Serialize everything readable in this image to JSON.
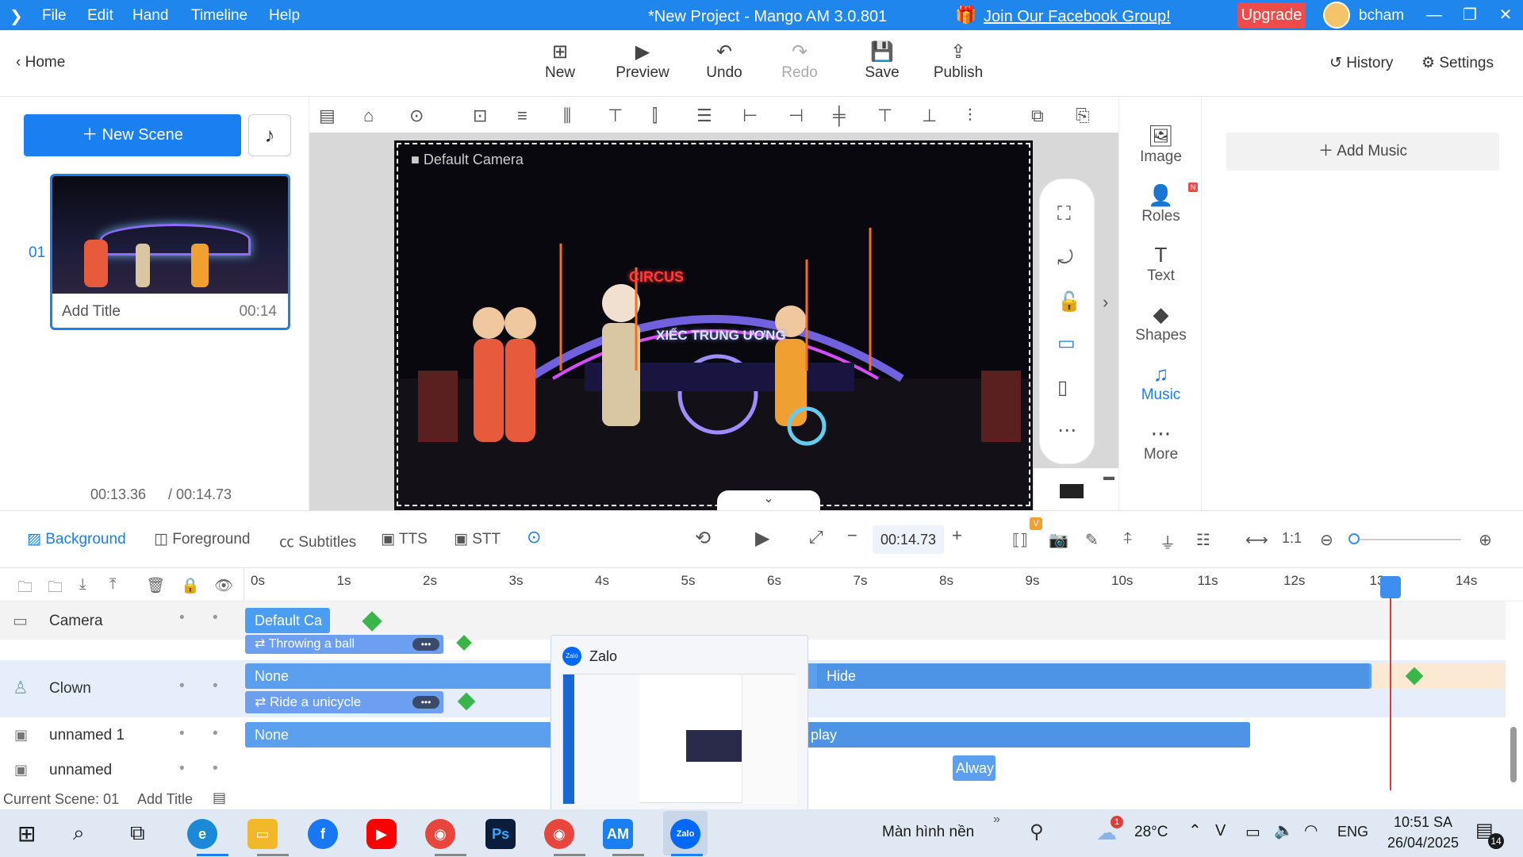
{
  "titlebar": {
    "menu": [
      "File",
      "Edit",
      "Hand",
      "Timeline",
      "Help"
    ],
    "title": "*New Project - Mango AM 3.0.801",
    "facebook_link": "Join Our Facebook Group!",
    "upgrade": "Upgrade",
    "username": "bcham"
  },
  "toolbar": {
    "home": "Home",
    "new": "New",
    "preview": "Preview",
    "undo": "Undo",
    "redo": "Redo",
    "save": "Save",
    "publish": "Publish",
    "history": "History",
    "settings": "Settings"
  },
  "scenes": {
    "new_scene": "New Scene",
    "items": [
      {
        "number": "01",
        "title": "Add Title",
        "duration": "00:14"
      }
    ],
    "time_current": "00:13.36",
    "time_total": "/ 00:14.73"
  },
  "stage": {
    "camera_label": "Default Camera",
    "sign_circus": "CIRCUS",
    "sign_banner": "XIẾC TRUNG ƯƠNG"
  },
  "assets": {
    "tabs": [
      {
        "label": "Image",
        "icon": "image-icon"
      },
      {
        "label": "Roles",
        "icon": "roles-icon",
        "badge": "N"
      },
      {
        "label": "Text",
        "icon": "text-icon"
      },
      {
        "label": "Shapes",
        "icon": "shapes-icon"
      },
      {
        "label": "Music",
        "icon": "music-icon",
        "active": true
      },
      {
        "label": "More",
        "icon": "more-icon"
      }
    ],
    "add_music": "Add Music"
  },
  "lower": {
    "tabs": [
      "Background",
      "Foreground",
      "Subtitles",
      "TTS",
      "STT"
    ],
    "time": "00:14.73",
    "badge_v": "V"
  },
  "timeline": {
    "ruler": [
      "0s",
      "1s",
      "2s",
      "3s",
      "4s",
      "5s",
      "6s",
      "7s",
      "8s",
      "9s",
      "10s",
      "11s",
      "12s",
      "13s",
      "14s"
    ],
    "tracks": [
      {
        "name": "Camera",
        "bar": "Default Ca"
      },
      {
        "name": "",
        "bar": "Throwing a ball"
      },
      {
        "name": "Clown",
        "bar": "None",
        "bar2": "Hide",
        "action": "Ride a unicycle"
      },
      {
        "name": "unnamed 1",
        "bar": "None",
        "bar2": "play"
      },
      {
        "name": "unnamed",
        "bar": "Alway"
      }
    ],
    "current_scene": "Current Scene: 01",
    "add_title": "Add Title"
  },
  "popup": {
    "title": "Zalo"
  },
  "taskbar": {
    "desktop_label": "Màn hình nền",
    "weather": "28°C",
    "weather_badge": "1",
    "lang": "ENG",
    "time": "10:51 SA",
    "date": "26/04/2025",
    "notifications": "14",
    "apps": [
      "Edge",
      "File Explorer",
      "Facebook",
      "YouTube",
      "Chrome",
      "Photoshop",
      "Chrome profile",
      "AM",
      "Zalo"
    ]
  },
  "colors": {
    "accent": "#1a7ff0",
    "titlebar": "#1f86ee",
    "upgrade": "#f04b4b",
    "playhead": "#e43a3a",
    "keyframe": "#39b54a"
  }
}
